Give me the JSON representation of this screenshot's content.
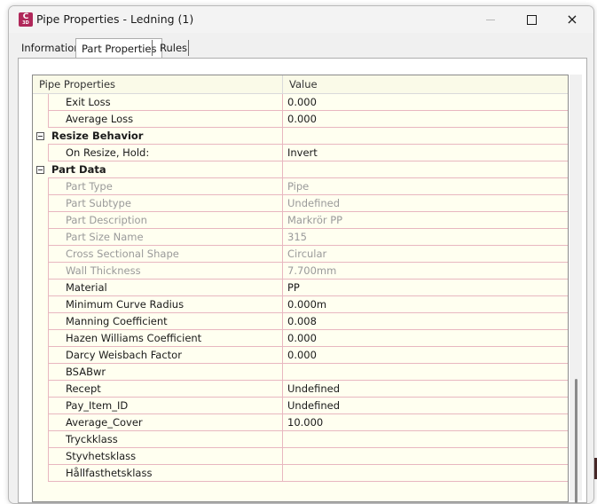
{
  "window": {
    "title": "Pipe Properties - Ledning (1)",
    "icon_letter": "C",
    "icon_sub": "3D",
    "controls": {
      "minimize": "minimize-icon",
      "maximize": "maximize-icon",
      "close": "×"
    }
  },
  "tabs": [
    {
      "label": "Information",
      "active": false
    },
    {
      "label": "Part Properties",
      "active": true
    },
    {
      "label": "Rules",
      "active": false
    }
  ],
  "grid": {
    "header": {
      "property": "Pipe Properties",
      "value": "Value"
    },
    "rows": [
      {
        "kind": "prop",
        "name": "Exit Loss",
        "value": "0.000",
        "disabled": false
      },
      {
        "kind": "prop",
        "name": "Average Loss",
        "value": "0.000",
        "disabled": false
      },
      {
        "kind": "category",
        "name": "Resize Behavior",
        "value": ""
      },
      {
        "kind": "prop",
        "name": "On Resize, Hold:",
        "value": "Invert",
        "disabled": false
      },
      {
        "kind": "category",
        "name": "Part Data",
        "value": ""
      },
      {
        "kind": "prop",
        "name": "Part Type",
        "value": "Pipe",
        "disabled": true
      },
      {
        "kind": "prop",
        "name": "Part Subtype",
        "value": "Undefined",
        "disabled": true
      },
      {
        "kind": "prop",
        "name": "Part Description",
        "value": "Markrör PP",
        "disabled": true
      },
      {
        "kind": "prop",
        "name": "Part Size Name",
        "value": "315",
        "disabled": true
      },
      {
        "kind": "prop",
        "name": "Cross Sectional Shape",
        "value": "Circular",
        "disabled": true
      },
      {
        "kind": "prop",
        "name": "Wall Thickness",
        "value": "7.700mm",
        "disabled": true
      },
      {
        "kind": "prop",
        "name": "Material",
        "value": "PP",
        "disabled": false
      },
      {
        "kind": "prop",
        "name": "Minimum Curve Radius",
        "value": "0.000m",
        "disabled": false
      },
      {
        "kind": "prop",
        "name": "Manning Coefficient",
        "value": "0.008",
        "disabled": false
      },
      {
        "kind": "prop",
        "name": "Hazen Williams Coefficient",
        "value": "0.000",
        "disabled": false
      },
      {
        "kind": "prop",
        "name": "Darcy Weisbach Factor",
        "value": "0.000",
        "disabled": false
      },
      {
        "kind": "prop",
        "name": "BSABwr",
        "value": "",
        "disabled": false
      },
      {
        "kind": "prop",
        "name": "Recept",
        "value": "Undefined",
        "disabled": false
      },
      {
        "kind": "prop",
        "name": "Pay_Item_ID",
        "value": "Undefined",
        "disabled": false
      },
      {
        "kind": "prop",
        "name": "Average_Cover",
        "value": "10.000",
        "disabled": false
      },
      {
        "kind": "prop",
        "name": "Tryckklass",
        "value": "",
        "disabled": false
      },
      {
        "kind": "prop",
        "name": "Styvhetsklass",
        "value": "",
        "disabled": false
      },
      {
        "kind": "prop",
        "name": "Hållfasthetsklass",
        "value": "",
        "disabled": false
      }
    ]
  },
  "colors": {
    "grid_background": "#fffff0",
    "row_line": "#e8b7c0",
    "disabled_text": "#9a9a9a"
  }
}
